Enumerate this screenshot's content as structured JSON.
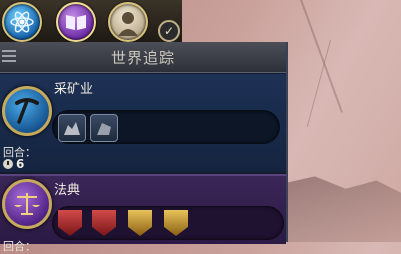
{
  "advisors": [
    {
      "icon": "atom-icon"
    },
    {
      "icon": "book-icon"
    },
    {
      "icon": "leader-portrait-icon"
    }
  ],
  "tracker": {
    "title": "世界追踪",
    "research": {
      "name": "采矿业",
      "icon": "pickaxe-icon",
      "turns_label": "回合：",
      "turns": "6",
      "unlocks": [
        "mine-improvement-icon",
        "quarry-improvement-icon"
      ]
    },
    "civic": {
      "name": "法典",
      "icon": "scales-icon",
      "turns_label": "回合：",
      "unlocks": [
        "military-policy-card",
        "military-policy-card",
        "economic-policy-card",
        "economic-policy-card"
      ]
    }
  },
  "colors": {
    "research_bg": "#1e3155",
    "civic_bg": "#3b2658",
    "frame_gold": "#c6a95a"
  }
}
